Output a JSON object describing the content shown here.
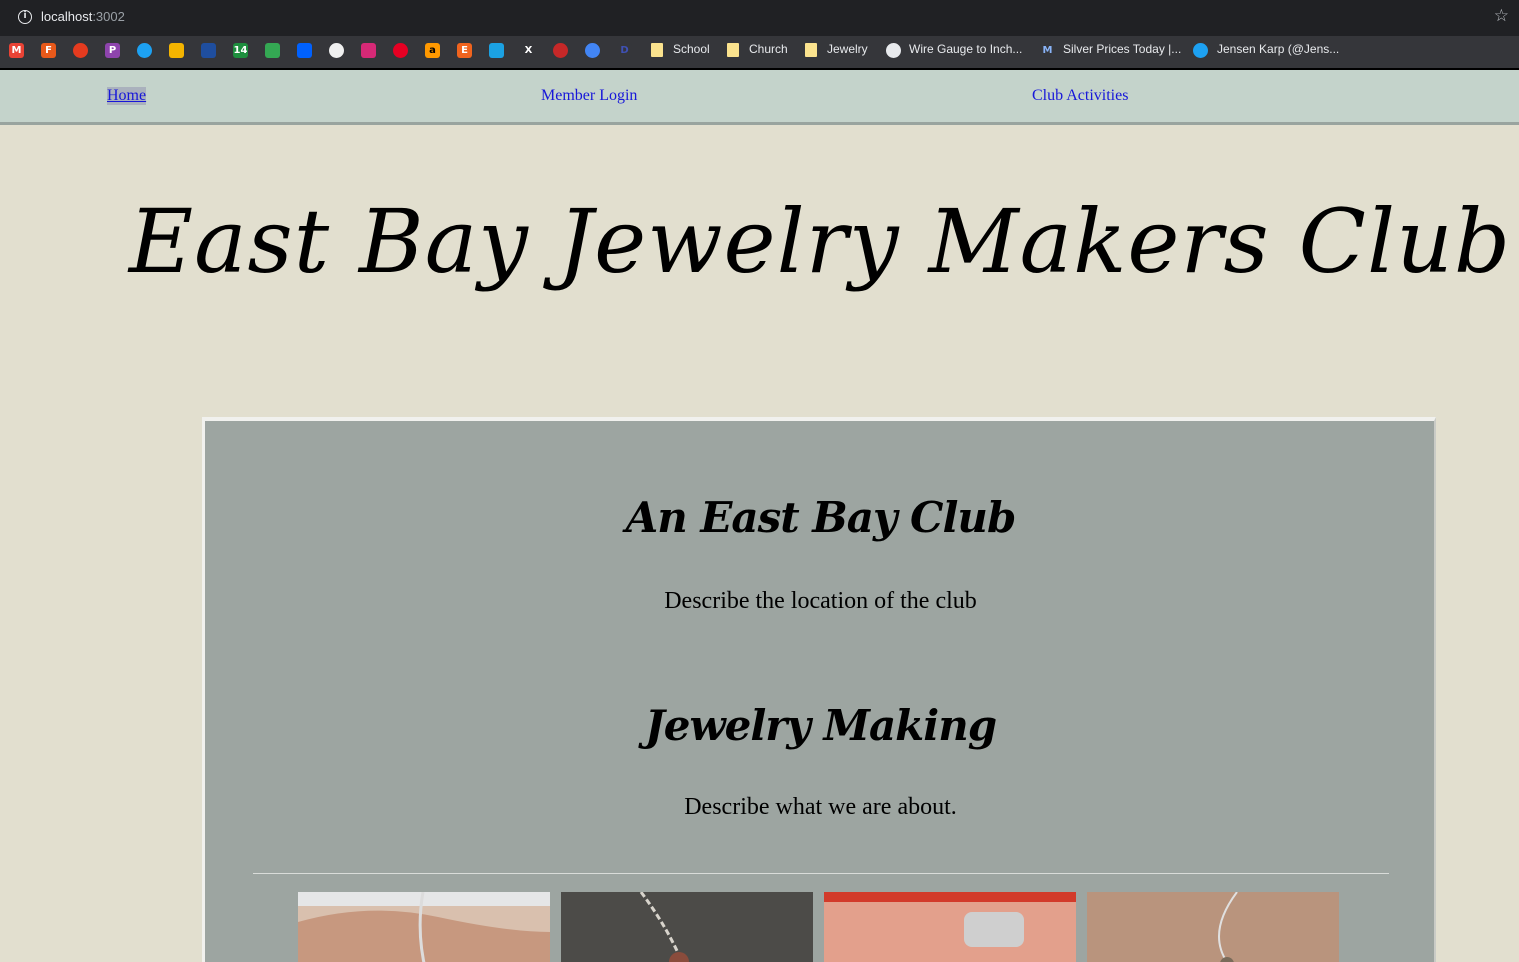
{
  "browser": {
    "url_host": "localhost",
    "url_port": ":3002",
    "bookmarks": [
      {
        "icon": "gmail-icon",
        "label": ""
      },
      {
        "icon": "fire-icon",
        "label": ""
      },
      {
        "icon": "tomato-icon",
        "label": ""
      },
      {
        "icon": "paypal-icon",
        "label": ""
      },
      {
        "icon": "twitter-icon",
        "label": ""
      },
      {
        "icon": "gift-icon",
        "label": ""
      },
      {
        "icon": "weather-icon",
        "label": ""
      },
      {
        "icon": "calendar-icon",
        "label": "14"
      },
      {
        "icon": "google-drive-icon",
        "label": ""
      },
      {
        "icon": "dropbox-icon",
        "label": ""
      },
      {
        "icon": "github-icon",
        "label": ""
      },
      {
        "icon": "instagram-icon",
        "label": ""
      },
      {
        "icon": "pinterest-icon",
        "label": ""
      },
      {
        "icon": "amazon-icon",
        "label": "a"
      },
      {
        "icon": "etsy-icon",
        "label": "E"
      },
      {
        "icon": "app-icon",
        "label": ""
      },
      {
        "icon": "x-icon",
        "label": "X"
      },
      {
        "icon": "c-icon",
        "label": ""
      },
      {
        "icon": "chrome-icon",
        "label": ""
      },
      {
        "icon": "disney-icon",
        "label": ""
      }
    ],
    "folders": [
      "School",
      "Church",
      "Jewelry"
    ],
    "links": [
      "Wire Gauge to Inch...",
      "Silver Prices Today |...",
      "Jensen Karp (@Jens..."
    ]
  },
  "nav": {
    "home": "Home",
    "member_login": "Member Login",
    "club_activities": "Club Activities"
  },
  "site_title": "East Bay Jewelry Makers Club",
  "main": {
    "section1_heading": "An East Bay Club",
    "section1_text": "Describe the location of the club",
    "section2_heading": "Jewelry Making",
    "section2_text": "Describe what we are about."
  },
  "colors": {
    "page_bg": "#e2dfcf",
    "nav_bg": "#c4d3cb",
    "panel_bg": "#9da5a1",
    "link": "#1717d9"
  }
}
